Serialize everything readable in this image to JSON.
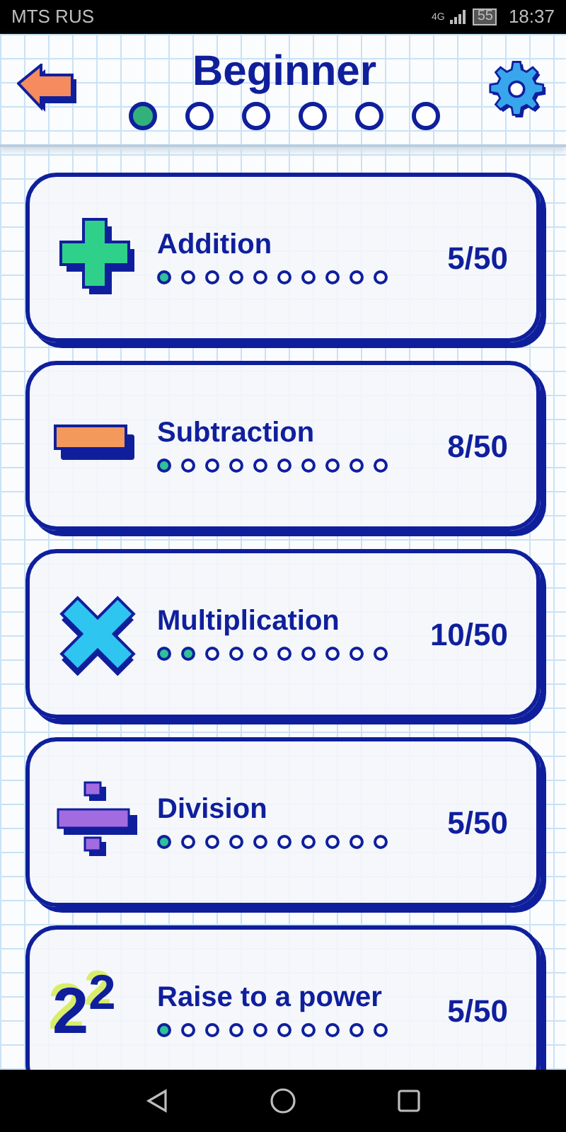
{
  "status_bar": {
    "carrier": "MTS RUS",
    "network": "4G",
    "battery": "55",
    "time": "18:37"
  },
  "header": {
    "title": "Beginner",
    "levels": [
      {
        "selected": true
      },
      {
        "selected": false
      },
      {
        "selected": false
      },
      {
        "selected": false
      },
      {
        "selected": false
      },
      {
        "selected": false
      }
    ]
  },
  "categories": [
    {
      "kind": "plus",
      "name": "Addition",
      "score": "5/50",
      "dots": [
        {
          "filled": true
        },
        {
          "filled": false
        },
        {
          "filled": false
        },
        {
          "filled": false
        },
        {
          "filled": false
        },
        {
          "filled": false
        },
        {
          "filled": false
        },
        {
          "filled": false
        },
        {
          "filled": false
        },
        {
          "filled": false
        }
      ]
    },
    {
      "kind": "minus",
      "name": "Subtraction",
      "score": "8/50",
      "dots": [
        {
          "filled": true
        },
        {
          "filled": false
        },
        {
          "filled": false
        },
        {
          "filled": false
        },
        {
          "filled": false
        },
        {
          "filled": false
        },
        {
          "filled": false
        },
        {
          "filled": false
        },
        {
          "filled": false
        },
        {
          "filled": false
        }
      ]
    },
    {
      "kind": "times",
      "name": "Multiplication",
      "score": "10/50",
      "dots": [
        {
          "filled": true
        },
        {
          "filled": true
        },
        {
          "filled": false
        },
        {
          "filled": false
        },
        {
          "filled": false
        },
        {
          "filled": false
        },
        {
          "filled": false
        },
        {
          "filled": false
        },
        {
          "filled": false
        },
        {
          "filled": false
        }
      ]
    },
    {
      "kind": "divide",
      "name": "Division",
      "score": "5/50",
      "dots": [
        {
          "filled": true
        },
        {
          "filled": false
        },
        {
          "filled": false
        },
        {
          "filled": false
        },
        {
          "filled": false
        },
        {
          "filled": false
        },
        {
          "filled": false
        },
        {
          "filled": false
        },
        {
          "filled": false
        },
        {
          "filled": false
        }
      ]
    },
    {
      "kind": "power",
      "icon_text": "2$^{2}$",
      "name": "Raise to a power",
      "score": "5/50",
      "dots": [
        {
          "filled": true
        },
        {
          "filled": false
        },
        {
          "filled": false
        },
        {
          "filled": false
        },
        {
          "filled": false
        },
        {
          "filled": false
        },
        {
          "filled": false
        },
        {
          "filled": false
        },
        {
          "filled": false
        },
        {
          "filled": false
        }
      ]
    }
  ]
}
